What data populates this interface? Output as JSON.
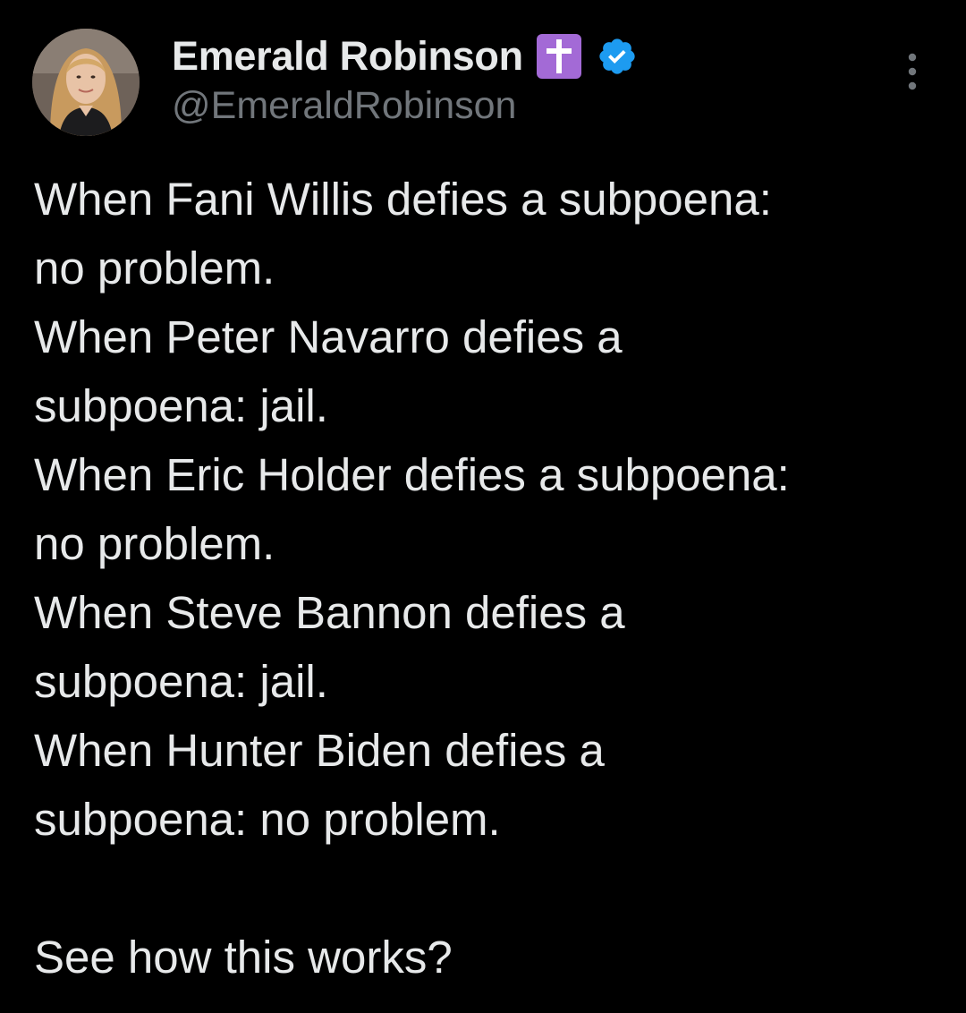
{
  "author": {
    "display_name": "Emerald Robinson",
    "handle": "@EmeraldRobinson",
    "name_emoji": "latin-cross-emoji",
    "verified": true,
    "verified_color": "#1d9bf0"
  },
  "tweet": {
    "text": "When Fani Willis defies a subpoena:\nno problem.\nWhen Peter Navarro defies a\nsubpoena: jail.\nWhen Eric Holder defies a subpoena:\nno problem.\nWhen Steve Bannon defies a\nsubpoena: jail.\nWhen Hunter Biden defies a\nsubpoena: no problem.\n\nSee how this works?"
  },
  "menu": {
    "icon": "more-vertical-icon"
  },
  "colors": {
    "background": "#000000",
    "text_primary": "#e7e9ea",
    "text_secondary": "#71767b",
    "cross_emoji_bg": "#a36ad6"
  }
}
